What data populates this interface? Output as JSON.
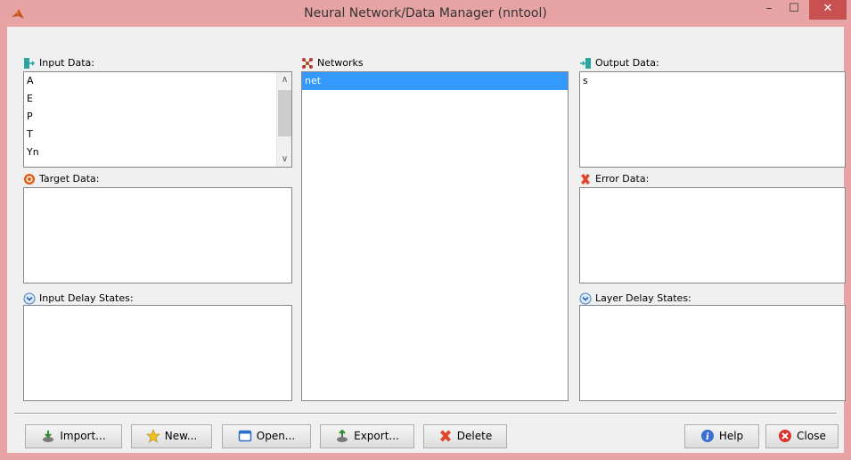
{
  "window": {
    "title": "Neural Network/Data Manager (nntool)",
    "min_label": "–",
    "max_label": "☐",
    "close_label": "✕"
  },
  "panels": {
    "input_data": {
      "label": "Input Data:",
      "items": [
        "A",
        "E",
        "P",
        "T",
        "Yn"
      ]
    },
    "target_data": {
      "label": "Target Data:",
      "items": []
    },
    "input_delay_states": {
      "label": "Input Delay States:",
      "items": []
    },
    "networks": {
      "label": "Networks",
      "items": [
        "net"
      ],
      "selected": "net"
    },
    "output_data": {
      "label": "Output Data:",
      "items": [
        "s"
      ]
    },
    "error_data": {
      "label": "Error Data:",
      "items": []
    },
    "layer_delay_states": {
      "label": "Layer Delay States:",
      "items": []
    }
  },
  "buttons": {
    "import": "Import...",
    "new": "New...",
    "open": "Open...",
    "export": "Export...",
    "delete": "Delete",
    "help": "Help",
    "close": "Close"
  },
  "scrollbar": {
    "up": "∧",
    "down": "∨"
  },
  "colors": {
    "titlebar": "#e8a4a4",
    "selection": "#3399ff",
    "close_button": "#c75050"
  }
}
